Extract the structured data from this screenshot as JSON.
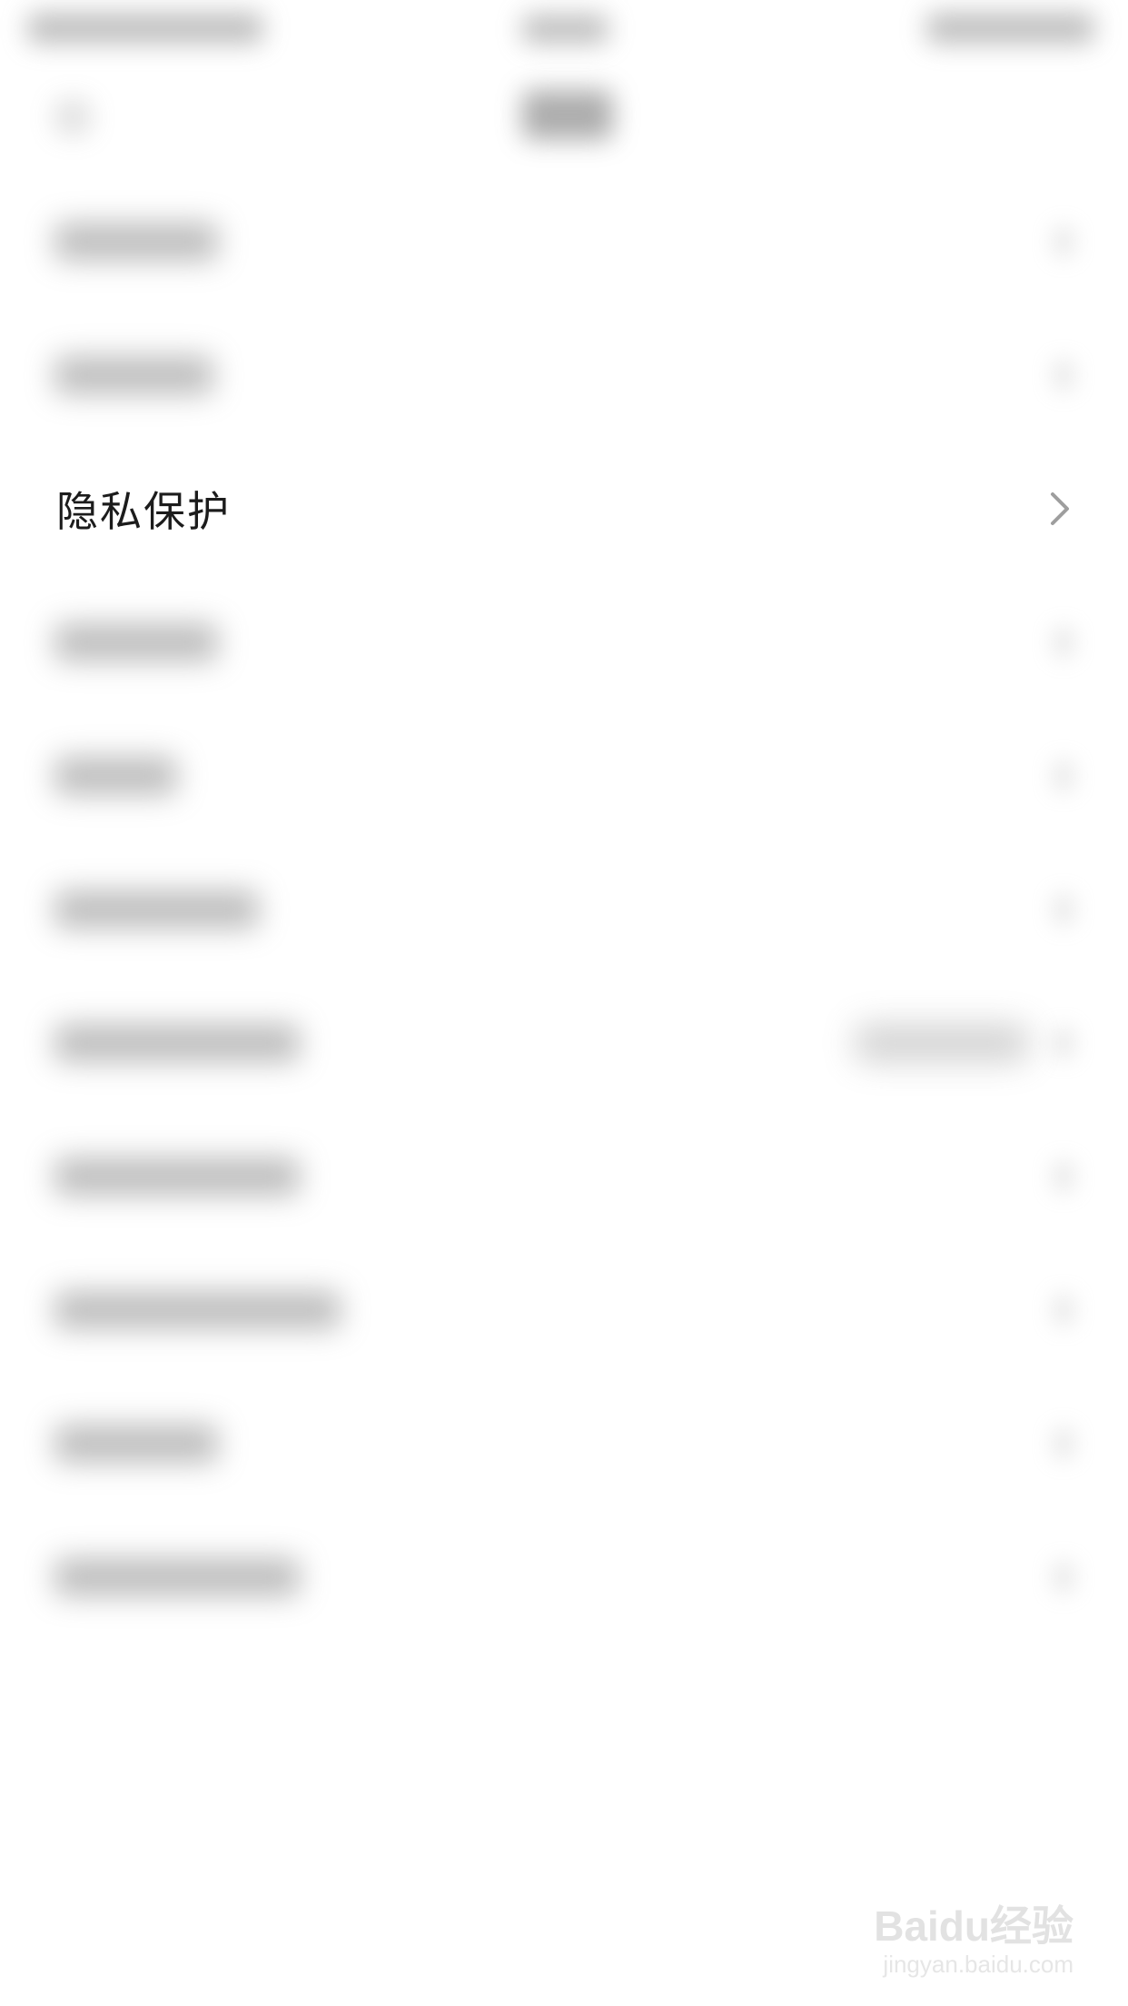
{
  "privacy_row": {
    "label": "隐私保护"
  },
  "watermark": {
    "logo": "Baidu经验",
    "url": "jingyan.baidu.com"
  },
  "icons": {
    "row_chevron": "chevron-right-icon"
  },
  "colors": {
    "background": "#ffffff",
    "text": "#1c1c1c",
    "chevron": "#9e9e9e"
  }
}
